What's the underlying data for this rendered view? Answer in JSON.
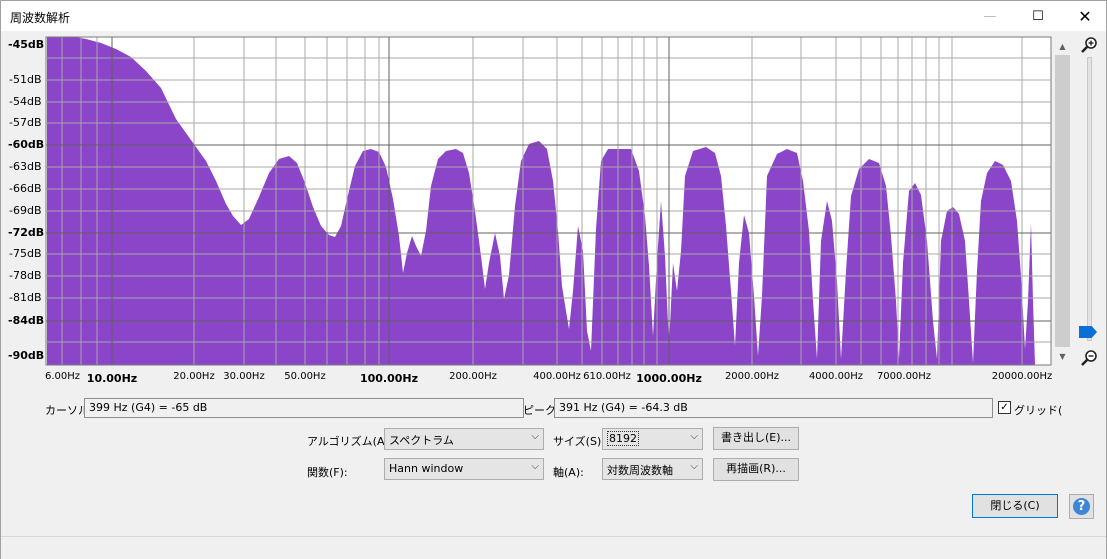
{
  "window": {
    "title": "周波数解析",
    "minimize": "—",
    "maximize": "☐",
    "close": "✕"
  },
  "plot": {
    "bg_color": "#ffffff",
    "fill_color": "#8b45c8",
    "y_labels": [
      {
        "text": "-45dB",
        "major": true
      },
      {
        "text": "-51dB",
        "major": false
      },
      {
        "text": "-54dB",
        "major": false
      },
      {
        "text": "-57dB",
        "major": false
      },
      {
        "text": "-60dB",
        "major": true
      },
      {
        "text": "-63dB",
        "major": false
      },
      {
        "text": "-66dB",
        "major": false
      },
      {
        "text": "-69dB",
        "major": false
      },
      {
        "text": "-72dB",
        "major": true
      },
      {
        "text": "-75dB",
        "major": false
      },
      {
        "text": "-78dB",
        "major": false
      },
      {
        "text": "-81dB",
        "major": false
      },
      {
        "text": "-84dB",
        "major": true
      },
      {
        "text": "-90dB",
        "major": true
      }
    ],
    "x_labels": [
      {
        "text": "6.00Hz",
        "major": false
      },
      {
        "text": "10.00Hz",
        "major": true
      },
      {
        "text": "20.00Hz",
        "major": false
      },
      {
        "text": "30.00Hz",
        "major": false
      },
      {
        "text": "50.00Hz",
        "major": false
      },
      {
        "text": "100.00Hz",
        "major": true
      },
      {
        "text": "200.00Hz",
        "major": false
      },
      {
        "text": "400.00Hz",
        "major": false
      },
      {
        "text": "610.00Hz",
        "major": false
      },
      {
        "text": "1000.00Hz",
        "major": true
      },
      {
        "text": "2000.00Hz",
        "major": false
      },
      {
        "text": "4000.00Hz",
        "major": false
      },
      {
        "text": "7000.00Hz",
        "major": false
      },
      {
        "text": "20000.00Hz",
        "major": false
      }
    ]
  },
  "cursor": {
    "label": "カーソル:",
    "value": "399 Hz (G4) = -65 dB"
  },
  "peak": {
    "label": "ピーク:",
    "value": "391 Hz (G4) = -64.3 dB"
  },
  "grid": {
    "label": "グリッド(",
    "checked": true
  },
  "controls": {
    "algorithm_label": "アルゴリズム(A):",
    "algorithm_value": "スペクトラム",
    "size_label": "サイズ(S):",
    "size_value": "8192",
    "export_button": "書き出し(E)...",
    "function_label": "関数(F):",
    "function_value": "Hann window",
    "axis_label": "軸(A):",
    "axis_value": "対数周波数軸",
    "replot_button": "再描画(R)...",
    "close_button": "閉じる(C)",
    "help": "?"
  },
  "icons": {
    "zoom_in": "zoom-in-icon",
    "zoom_out": "zoom-out-icon",
    "scroll_up": "▲",
    "scroll_down": "▼",
    "combo_arrow": "⌵"
  }
}
